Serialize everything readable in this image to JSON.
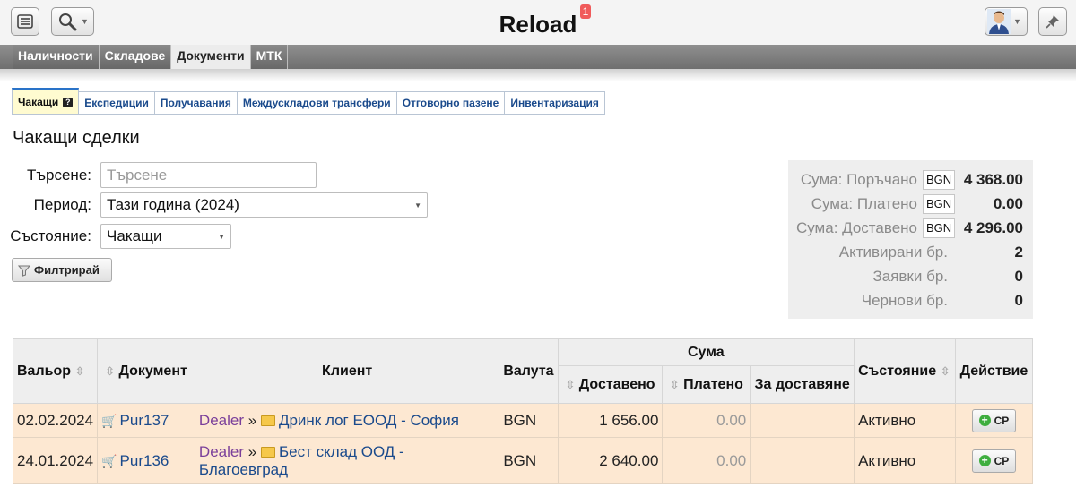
{
  "app": {
    "title": "Reload",
    "notifications": "1"
  },
  "icons": {
    "menu": "hamburger-icon",
    "search": "magnifier-icon",
    "user": "user-avatar-icon",
    "pin": "pin-icon",
    "help": "help-icon",
    "filter": "funnel-icon",
    "add": "plus-icon",
    "folder": "folder-icon",
    "doc": "cart-icon"
  },
  "main_nav": [
    "Наличности",
    "Складове",
    "Документи",
    "МТК"
  ],
  "sub_tabs": [
    "Чакащи",
    "Експедиции",
    "Получавания",
    "Междускладови трансфери",
    "Отговорно пазене",
    "Инвентаризация"
  ],
  "page_title": "Чакащи сделки",
  "filters": {
    "search_label": "Търсене:",
    "search_placeholder": "Търсене",
    "period_label": "Период:",
    "period_value": "Тази година (2024)",
    "status_label": "Състояние:",
    "status_value": "Чакащи",
    "filter_button": "Филтрирай"
  },
  "summary": {
    "ordered_label": "Сума: Поръчано",
    "ordered_currency": "BGN",
    "ordered_value": "4 368.00",
    "paid_label": "Сума: Платено",
    "paid_currency": "BGN",
    "paid_value": "0.00",
    "delivered_label": "Сума: Доставено",
    "delivered_currency": "BGN",
    "delivered_value": "4 296.00",
    "activated_label": "Активирани бр.",
    "activated_value": "2",
    "requests_label": "Заявки бр.",
    "requests_value": "0",
    "drafts_label": "Чернови бр.",
    "drafts_value": "0"
  },
  "table": {
    "headers": {
      "valor": "Вальор",
      "document": "Документ",
      "client": "Клиент",
      "currency": "Валута",
      "sum": "Сума",
      "delivered": "Доставено",
      "paid": "Платено",
      "to_deliver": "За доставяне",
      "status": "Състояние",
      "action": "Действие"
    },
    "rows": [
      {
        "date": "02.02.2024",
        "doc": "Pur137",
        "dealer": "Dealer",
        "sep": "»",
        "client": "Дринк лог ЕООД - София",
        "currency": "BGN",
        "delivered": "1 656.00",
        "paid": "0.00",
        "to_deliver": "",
        "status": "Активно",
        "action": "СР"
      },
      {
        "date": "24.01.2024",
        "doc": "Pur136",
        "dealer": "Dealer",
        "sep": "»",
        "client": "Бест склад ООД - Благоевград",
        "currency": "BGN",
        "delivered": "2 640.00",
        "paid": "0.00",
        "to_deliver": "",
        "status": "Активно",
        "action": "СР"
      }
    ]
  },
  "colors": {
    "row_bg": "#fde8d2",
    "link": "#1a4a8c",
    "dealer": "#7a3f9a",
    "active_tab_bg": "#fffbd0",
    "nav_bg": "#7a7a7a",
    "badge": "#f05b5b",
    "add_green": "#3fae3f"
  }
}
